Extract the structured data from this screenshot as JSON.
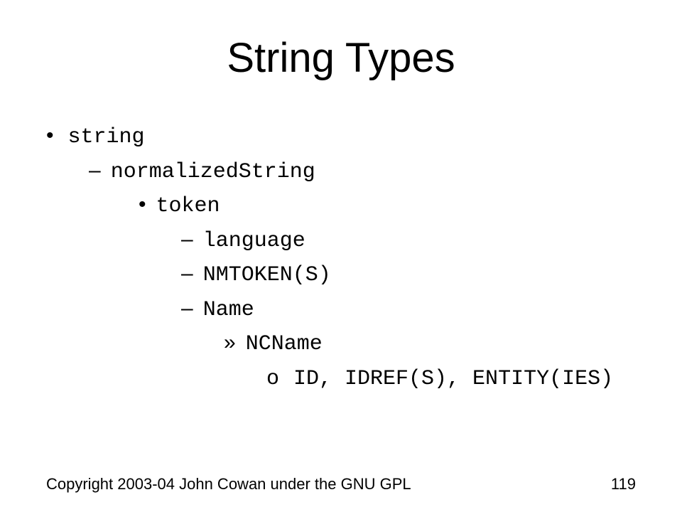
{
  "title": "String Types",
  "list": {
    "l1": "string",
    "l2": "normalizedString",
    "l3": "token",
    "l4a": "language",
    "l4b": "NMTOKEN(S)",
    "l4c": "Name",
    "l5": "NCName",
    "l6": "ID, IDREF(S), ENTITY(IES)"
  },
  "footer": {
    "copyright": "Copyright 2003-04 John Cowan under the GNU GPL",
    "page": "119"
  }
}
